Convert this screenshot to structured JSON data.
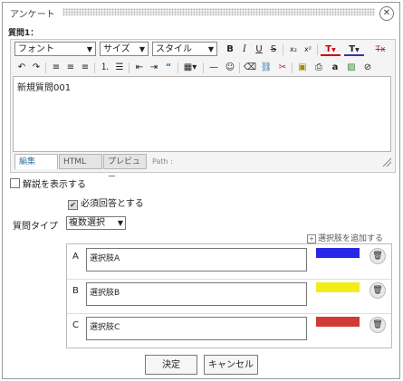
{
  "dialog": {
    "title": "アンケート",
    "close_glyph": "✕"
  },
  "question": {
    "label": "質問1：",
    "body": "新規質問001"
  },
  "toolbar": {
    "font_select": "フォント",
    "size_select": "サイズ",
    "style_select": "スタイル",
    "bold": "B",
    "italic": "I",
    "underline": "U",
    "strike": "S",
    "subscript": "x₂",
    "superscript": "x²",
    "text_color": "T",
    "bg_color": "T",
    "remove_format": "Tx"
  },
  "editor_tabs": {
    "edit": "編集",
    "html": "HTML",
    "preview": "プレビュー",
    "path": "Path :"
  },
  "options": {
    "show_explanation": "解説を表示する",
    "required": "必須回答とする"
  },
  "question_type": {
    "label": "質問タイプ",
    "value": "複数選択"
  },
  "add_choice": "選択肢を追加する",
  "choices": [
    {
      "letter": "A",
      "text": "選択肢A",
      "color": "#2727e6"
    },
    {
      "letter": "B",
      "text": "選択肢B",
      "color": "#f2ec1a"
    },
    {
      "letter": "C",
      "text": "選択肢C",
      "color": "#d23b35"
    }
  ],
  "buttons": {
    "ok": "決定",
    "cancel": "キャンセル"
  }
}
